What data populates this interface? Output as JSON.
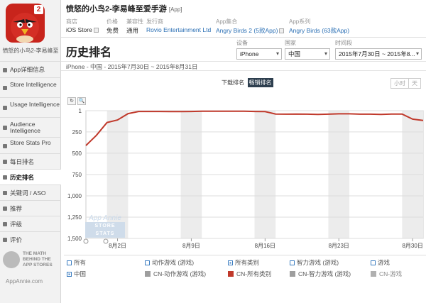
{
  "app": {
    "title": "愤怒的小鸟2-李易峰至爱手游",
    "title_tag": "[App]",
    "sidebar_name": "愤怒的小鸟2-李易峰至",
    "icon_badge": "2"
  },
  "meta": [
    {
      "key": "商店",
      "value": "iOS Store",
      "dropdown": true
    },
    {
      "key": "价格",
      "value": "免费"
    },
    {
      "key": "兼容性",
      "value": "通用"
    },
    {
      "key": "发行商",
      "value": "Rovio Entertainment Ltd",
      "link": true
    },
    {
      "key": "App集合",
      "value": "Angry Birds 2 (5款App)",
      "link": true,
      "dropdown": true
    },
    {
      "key": "App系列",
      "value": "Angry Birds (63款App)",
      "link": true
    }
  ],
  "sidebar": {
    "items": [
      {
        "label": "App详细信息",
        "icon": "info-icon"
      },
      {
        "label": "Store Intelligence",
        "icon": "store-icon"
      },
      {
        "label": "Usage Intelligence",
        "icon": "usage-icon"
      },
      {
        "label": "Audience Intelligence",
        "icon": "audience-icon"
      },
      {
        "label": "Store Stats Pro",
        "icon": "stats-icon"
      },
      {
        "label": "每日排名",
        "icon": "calendar-icon"
      },
      {
        "label": "历史排名",
        "icon": "history-icon",
        "active": true
      },
      {
        "label": "关键词 / ASO",
        "icon": "keyword-icon"
      },
      {
        "label": "推荐",
        "icon": "featured-icon"
      },
      {
        "label": "评级",
        "icon": "rating-icon"
      },
      {
        "label": "评价",
        "icon": "review-icon"
      }
    ],
    "logo_text": "THE MATH BEHIND THE APP STORES",
    "logo_url": "AppAnnie.com"
  },
  "page": {
    "title": "历史排名",
    "subtitle": "iPhone - 中国 - 2015年7月30日 ~ 2015年8月31日"
  },
  "filters": {
    "device": {
      "label": "设备",
      "value": "iPhone"
    },
    "country": {
      "label": "国家",
      "value": "中国"
    },
    "period": {
      "label": "时间段",
      "value": "2015年7月30日 ~ 2015年8..."
    }
  },
  "controls": {
    "rank_tabs": [
      "下载排名",
      "畅销排名"
    ],
    "active_tab": 1,
    "granularity": [
      "小时",
      "天"
    ],
    "zoom_reset": "↻",
    "zoom_in": "🔍"
  },
  "watermark": {
    "line1": "App Annie",
    "line2": "STORE STATS"
  },
  "chart_data": {
    "type": "line",
    "y_inverted": true,
    "ylim": [
      1,
      1500
    ],
    "yticks": [
      "1",
      "250",
      "500",
      "750",
      "1,000",
      "1,250",
      "1,500"
    ],
    "xticks": [
      "8月2日",
      "8月9日",
      "8月16日",
      "8月23日",
      "8月30日"
    ],
    "x": [
      "7/30",
      "7/31",
      "8/1",
      "8/2",
      "8/3",
      "8/4",
      "8/5",
      "8/6",
      "8/7",
      "8/8",
      "8/9",
      "8/10",
      "8/11",
      "8/12",
      "8/13",
      "8/14",
      "8/15",
      "8/16",
      "8/17",
      "8/18",
      "8/19",
      "8/20",
      "8/21",
      "8/22",
      "8/23",
      "8/24",
      "8/25",
      "8/26",
      "8/27",
      "8/28",
      "8/29",
      "8/30",
      "8/31"
    ],
    "series": [
      {
        "name": "CN-所有类别",
        "color": "#c0392b",
        "values": [
          410,
          290,
          140,
          110,
          35,
          10,
          10,
          10,
          12,
          12,
          10,
          8,
          8,
          8,
          8,
          8,
          10,
          12,
          40,
          42,
          40,
          42,
          45,
          42,
          38,
          38,
          42,
          42,
          45,
          40,
          40,
          100,
          115
        ]
      }
    ]
  },
  "legend": {
    "rows": [
      [
        {
          "label": "所有",
          "kind": "checkbox",
          "checked": false
        },
        {
          "label": "动作游戏 (游戏)",
          "kind": "checkbox",
          "checked": false
        },
        {
          "label": "所有类别",
          "kind": "checkbox",
          "checked": true
        },
        {
          "label": "智力游戏 (游戏)",
          "kind": "checkbox",
          "checked": false
        },
        {
          "label": "游戏",
          "kind": "checkbox",
          "checked": false
        }
      ],
      [
        {
          "label": "中国",
          "kind": "checkbox",
          "checked": true
        },
        {
          "label": "CN-动作游戏 (游戏)",
          "kind": "swatch",
          "color": "#9e9e9e"
        },
        {
          "label": "CN-所有类别",
          "kind": "swatch",
          "color": "#c0392b"
        },
        {
          "label": "CN-智力游戏 (游戏)",
          "kind": "swatch",
          "color": "#9e9e9e"
        },
        {
          "label": "CN-游戏",
          "kind": "swatch",
          "color": "#b0b0b0",
          "dim": true
        }
      ]
    ]
  }
}
